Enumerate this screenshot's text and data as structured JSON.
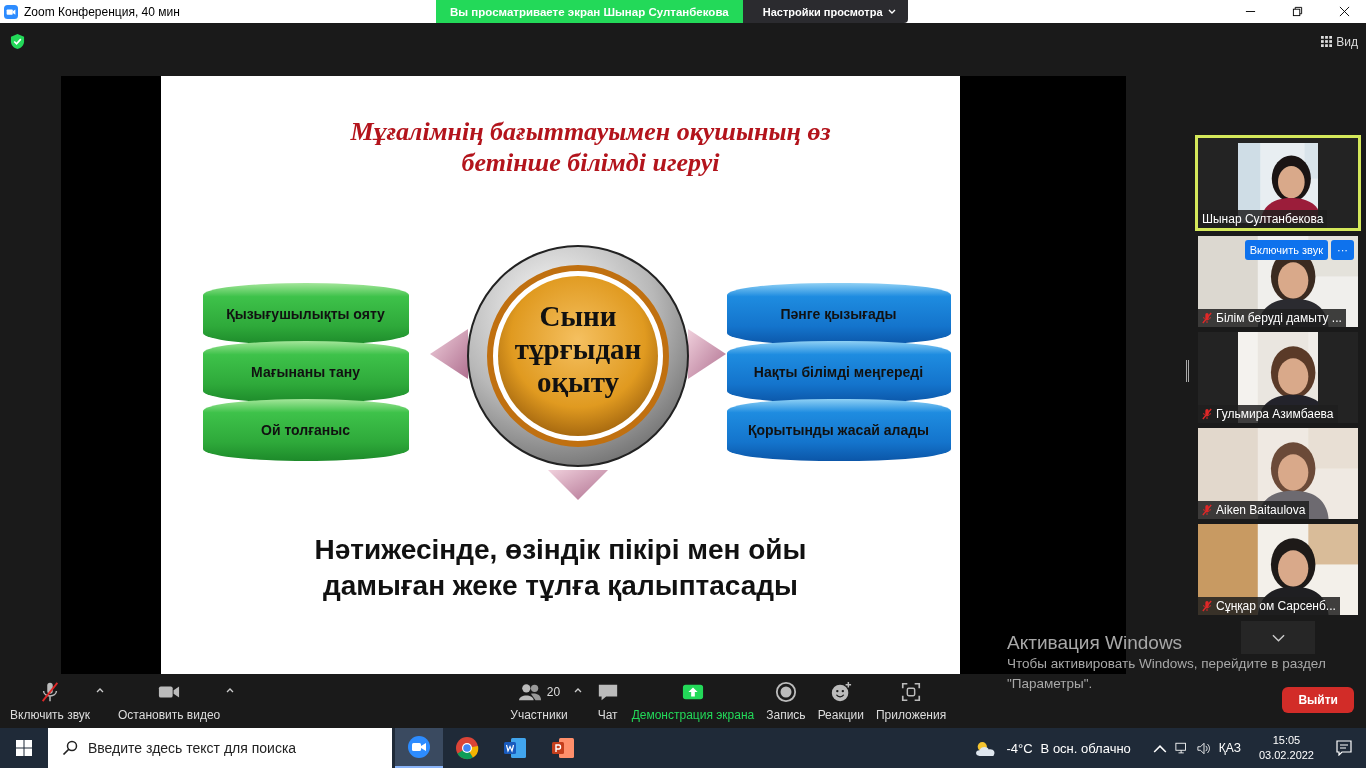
{
  "window": {
    "title": "Zoom Конференция, 40 мин"
  },
  "share_banner": {
    "text": "Вы просматриваете экран Шынар Султанбекова",
    "options": "Настройки просмотра"
  },
  "view_button": "Вид",
  "slide": {
    "title_lines": [
      "Мұғалімнің бағыттауымен оқушының өз",
      "бетінше білімді игеруі"
    ],
    "left_stack": [
      "Қызығушылықты ояту",
      "Мағынаны тану",
      "Ой толғаныс"
    ],
    "center_lines": [
      "Сыни",
      "тұрғыдан",
      "оқыту"
    ],
    "right_stack": [
      "Пәнге қызығады",
      "Нақты білімді меңгереді",
      "Қорытынды жасай алады"
    ],
    "conclusion_lines": [
      "Нәтижесінде, өзіндік пікірі мен ойы",
      "дамыған жеке тұлға қалыптасады"
    ]
  },
  "participants": [
    {
      "name": "Шынар Султанбекова",
      "muted": false,
      "speaking": true,
      "kind": "picture"
    },
    {
      "name": "Білім беруді дамыту ...",
      "muted": true,
      "speaking": false,
      "kind": "picture",
      "actions": [
        "Включить звук",
        "···"
      ]
    },
    {
      "name": "Гульмира Азимбаева",
      "muted": true,
      "speaking": false,
      "kind": "picture"
    },
    {
      "name": "Aiken Baitaulova",
      "muted": true,
      "speaking": false,
      "kind": "picture"
    },
    {
      "name": "Сұңқар ом Сарсенб...",
      "muted": true,
      "speaking": false,
      "kind": "picture"
    }
  ],
  "toolbar": [
    {
      "kind": "mic",
      "label": "Включить звук",
      "muted": true,
      "has_menu": true,
      "active": false
    },
    {
      "kind": "video",
      "label": "Остановить видео",
      "has_menu": true,
      "active": false
    },
    {
      "kind": "participants",
      "label": "Участники",
      "count": "20",
      "has_menu": true,
      "active": false
    },
    {
      "kind": "chat",
      "label": "Чат",
      "has_menu": false,
      "active": false
    },
    {
      "kind": "share",
      "label": "Демонстрация экрана",
      "has_menu": false,
      "active": true
    },
    {
      "kind": "record",
      "label": "Запись",
      "has_menu": false,
      "active": false
    },
    {
      "kind": "reactions",
      "label": "Реакции",
      "has_menu": false,
      "active": false
    },
    {
      "kind": "apps",
      "label": "Приложения",
      "has_menu": false,
      "active": false
    }
  ],
  "leave_button": "Выйти",
  "activation": {
    "title": "Активация Windows",
    "text": "Чтобы активировать Windows, перейдите в раздел \"Параметры\"."
  },
  "taskbar": {
    "search": {
      "placeholder": "Введите здесь текст для поиска"
    },
    "apps": [
      {
        "kind": "zoom",
        "selected": true
      },
      {
        "kind": "chrome",
        "selected": false
      },
      {
        "kind": "word",
        "selected": false
      },
      {
        "kind": "powerpoint",
        "selected": false
      }
    ],
    "temperature": "-4°C",
    "weather": "В осн. облачно",
    "language": "ҚАЗ",
    "time": "15:05",
    "date": "03.02.2022"
  }
}
